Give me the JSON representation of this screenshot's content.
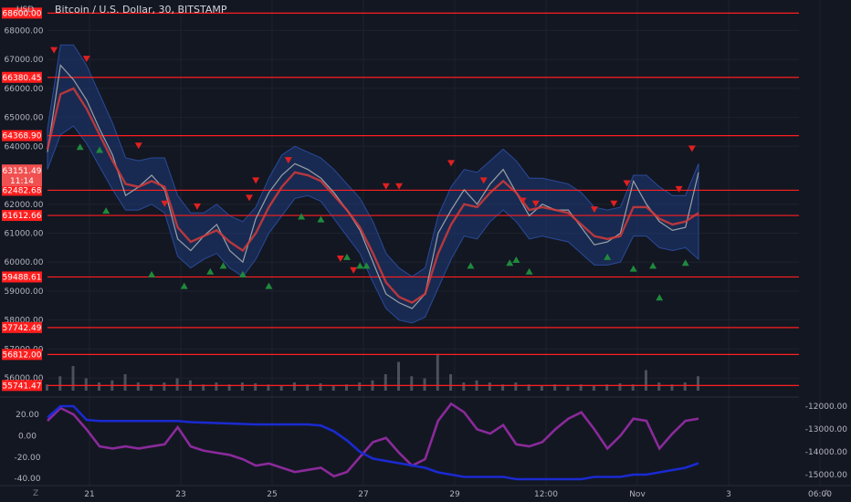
{
  "header": {
    "symbol_title": "Bitcoin / U.S. Dollar, 30, BITSTAMP",
    "currency": "USD"
  },
  "corners": {
    "left": "Z",
    "right": "A"
  },
  "colors": {
    "background": "#131722",
    "level_line": "#ff1e1e",
    "price_band": "#1e3a78",
    "moving_average": "#d23a3a",
    "price_series": "#9aa0a8",
    "volume": "#5a5f6a",
    "oscillator_purple": "#8a2a9a",
    "oscillator_blue": "#1a2ad0",
    "sell_marker": "#e02020",
    "buy_marker": "#1f8a3c",
    "current_price_label": "#f05050"
  },
  "chart_data": [
    {
      "type": "line",
      "title": "Bitcoin / U.S. Dollar, 30, BITSTAMP",
      "ylabel": "USD",
      "ylim": [
        55500,
        68800
      ],
      "price_ticks": [
        "68000.00",
        "67000.00",
        "66000.00",
        "65000.00",
        "64000.00",
        "62000.00",
        "61000.00",
        "60000.00",
        "59000.00",
        "58000.00",
        "57000.00",
        "56000.00"
      ],
      "x_ticks": [
        "21",
        "23",
        "25",
        "27",
        "29",
        "12:00",
        "Nov",
        "3",
        "06:00"
      ],
      "level_lines": [
        {
          "label": "68600.00",
          "value": 68600
        },
        {
          "label": "66380.45",
          "value": 66380.45
        },
        {
          "label": "64368.90",
          "value": 64368.9
        },
        {
          "label": "62482.68",
          "value": 62482.68
        },
        {
          "label": "61612.66",
          "value": 61612.66
        },
        {
          "label": "59488.61",
          "value": 59488.61
        },
        {
          "label": "57742.49",
          "value": 57742.49
        },
        {
          "label": "56812.00",
          "value": 56812
        },
        {
          "label": "55741.47",
          "value": 55741.47
        }
      ],
      "current_price": {
        "value": "63151.49",
        "countdown": "11:14",
        "y": 63151.49
      },
      "x": [
        0,
        2,
        4,
        6,
        8,
        10,
        12,
        14,
        16,
        18,
        20,
        22,
        24,
        26,
        28,
        30,
        32,
        34,
        36,
        38,
        40,
        42,
        44,
        46,
        48,
        50,
        52,
        54,
        56,
        58,
        60,
        62,
        64,
        66,
        68,
        70,
        72,
        74,
        76,
        78,
        80,
        82,
        84,
        86,
        88,
        90,
        92,
        94,
        96,
        98,
        100
      ],
      "series": [
        {
          "role": "close",
          "values": [
            63800,
            66800,
            66300,
            65600,
            64600,
            63700,
            62300,
            62600,
            63000,
            62500,
            60800,
            60400,
            60900,
            61300,
            60400,
            60000,
            61500,
            62400,
            63000,
            63400,
            63200,
            62900,
            62400,
            61800,
            61100,
            60000,
            58900,
            58600,
            58400,
            58900,
            61000,
            61800,
            62500,
            62000,
            62700,
            63200,
            62400,
            61600,
            62000,
            61800,
            61800,
            61200,
            60600,
            60700,
            61000,
            62800,
            62000,
            61400,
            61100,
            61200,
            63100
          ]
        },
        {
          "role": "moving_average",
          "values": [
            63900,
            65800,
            66000,
            65300,
            64400,
            63500,
            62700,
            62600,
            62800,
            62600,
            61200,
            60700,
            60900,
            61100,
            60700,
            60400,
            61000,
            61900,
            62600,
            63100,
            63000,
            62800,
            62300,
            61800,
            61200,
            60300,
            59300,
            58800,
            58600,
            58900,
            60300,
            61300,
            62000,
            61900,
            62400,
            62800,
            62400,
            61800,
            61900,
            61800,
            61700,
            61300,
            60900,
            60800,
            60900,
            61900,
            61900,
            61500,
            61300,
            61400,
            61700
          ]
        },
        {
          "role": "band_upper",
          "values": [
            64600,
            67500,
            67500,
            66800,
            65800,
            64800,
            63600,
            63500,
            63600,
            63600,
            62300,
            61700,
            61700,
            62000,
            61600,
            61400,
            61900,
            62900,
            63700,
            64000,
            63800,
            63600,
            63200,
            62700,
            62200,
            61400,
            60300,
            59800,
            59500,
            59800,
            61600,
            62600,
            63200,
            63100,
            63500,
            63900,
            63500,
            62900,
            62900,
            62800,
            62700,
            62400,
            61900,
            61800,
            61900,
            63000,
            63000,
            62600,
            62300,
            62300,
            63400
          ]
        },
        {
          "role": "band_lower",
          "values": [
            63200,
            64400,
            64700,
            64100,
            63300,
            62500,
            61800,
            61800,
            62000,
            61700,
            60200,
            59800,
            60100,
            60300,
            59800,
            59500,
            60100,
            61000,
            61600,
            62200,
            62300,
            62100,
            61500,
            60900,
            60300,
            59300,
            58400,
            58000,
            57900,
            58100,
            59100,
            60100,
            60900,
            60800,
            61400,
            61800,
            61400,
            60800,
            60900,
            60800,
            60700,
            60300,
            59900,
            59900,
            60000,
            60900,
            60900,
            60500,
            60400,
            60500,
            60100
          ]
        },
        {
          "role": "volume",
          "values": [
            0.15,
            0.35,
            0.6,
            0.3,
            0.2,
            0.25,
            0.4,
            0.2,
            0.15,
            0.2,
            0.3,
            0.25,
            0.15,
            0.2,
            0.15,
            0.2,
            0.18,
            0.15,
            0.12,
            0.2,
            0.15,
            0.18,
            0.12,
            0.15,
            0.2,
            0.25,
            0.4,
            0.7,
            0.35,
            0.3,
            0.9,
            0.4,
            0.2,
            0.25,
            0.2,
            0.15,
            0.2,
            0.15,
            0.12,
            0.15,
            0.1,
            0.15,
            0.12,
            0.15,
            0.18,
            0.15,
            0.5,
            0.2,
            0.15,
            0.2,
            0.35
          ]
        }
      ],
      "sell_markers": [
        [
          1,
          67300
        ],
        [
          6,
          67000
        ],
        [
          14,
          64000
        ],
        [
          18,
          62000
        ],
        [
          23,
          61900
        ],
        [
          31,
          62200
        ],
        [
          32,
          62800
        ],
        [
          37,
          63500
        ],
        [
          45,
          60100
        ],
        [
          47,
          59700
        ],
        [
          52,
          62600
        ],
        [
          54,
          62600
        ],
        [
          62,
          63400
        ],
        [
          67,
          62800
        ],
        [
          73,
          62100
        ],
        [
          75,
          62000
        ],
        [
          84,
          61800
        ],
        [
          87,
          62000
        ],
        [
          89,
          62700
        ],
        [
          97,
          62500
        ],
        [
          99,
          63900
        ]
      ],
      "buy_markers": [
        [
          5,
          64000
        ],
        [
          8,
          63900
        ],
        [
          9,
          61800
        ],
        [
          16,
          59600
        ],
        [
          21,
          59200
        ],
        [
          25,
          59700
        ],
        [
          27,
          59900
        ],
        [
          30,
          59600
        ],
        [
          34,
          59200
        ],
        [
          39,
          61600
        ],
        [
          42,
          61500
        ],
        [
          46,
          60200
        ],
        [
          48,
          59900
        ],
        [
          49,
          59900
        ],
        [
          65,
          59900
        ],
        [
          71,
          60000
        ],
        [
          72,
          60100
        ],
        [
          74,
          59700
        ],
        [
          86,
          60200
        ],
        [
          90,
          59800
        ],
        [
          94,
          58800
        ],
        [
          93,
          59900
        ],
        [
          98,
          60000
        ]
      ]
    },
    {
      "type": "line",
      "left_ticks": [
        "20.00",
        "0.00",
        "-20.00",
        "-40.00"
      ],
      "left_ylim": [
        -45,
        32
      ],
      "right_ticks": [
        "-12000.00",
        "-13000.00",
        "-14000.00",
        "-15000.00"
      ],
      "right_ylim": [
        -15400,
        -11800
      ],
      "x": [
        0,
        2,
        4,
        6,
        8,
        10,
        12,
        14,
        16,
        18,
        20,
        22,
        24,
        26,
        28,
        30,
        32,
        34,
        36,
        38,
        40,
        42,
        44,
        46,
        48,
        50,
        52,
        54,
        56,
        58,
        60,
        62,
        64,
        66,
        68,
        70,
        72,
        74,
        76,
        78,
        80,
        82,
        84,
        86,
        88,
        90,
        92,
        94,
        96,
        98,
        100
      ],
      "series": [
        {
          "role": "oscillator",
          "axis": "left",
          "values": [
            14,
            26,
            20,
            6,
            -10,
            -12,
            -10,
            -12,
            -10,
            -8,
            8,
            -10,
            -14,
            -16,
            -18,
            -22,
            -28,
            -26,
            -30,
            -34,
            -32,
            -30,
            -38,
            -34,
            -20,
            -6,
            -2,
            -16,
            -28,
            -22,
            14,
            30,
            22,
            6,
            2,
            10,
            -8,
            -10,
            -6,
            6,
            16,
            22,
            6,
            -12,
            0,
            16,
            14,
            -12,
            2,
            14,
            16
          ]
        },
        {
          "role": "flow",
          "axis": "right",
          "values": [
            -12500,
            -12000,
            -12000,
            -12600,
            -12650,
            -12650,
            -12650,
            -12650,
            -12650,
            -12650,
            -12650,
            -12700,
            -12720,
            -12740,
            -12760,
            -12780,
            -12800,
            -12800,
            -12800,
            -12800,
            -12800,
            -12850,
            -13100,
            -13500,
            -14000,
            -14300,
            -14400,
            -14500,
            -14600,
            -14700,
            -14900,
            -15000,
            -15100,
            -15100,
            -15100,
            -15100,
            -15200,
            -15200,
            -15200,
            -15200,
            -15200,
            -15200,
            -15100,
            -15100,
            -15100,
            -15000,
            -15000,
            -14900,
            -14800,
            -14700,
            -14500
          ]
        }
      ]
    }
  ]
}
